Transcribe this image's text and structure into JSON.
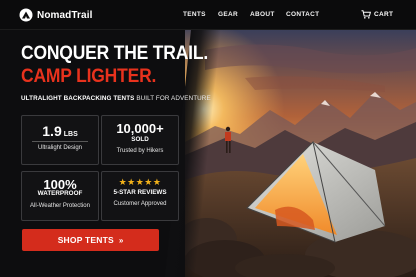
{
  "nav": {
    "brand": "NomadTrail",
    "links": [
      "TENTS",
      "GEAR",
      "ABOUT",
      "CONTACT"
    ],
    "cart_label": "CART",
    "brand_icon": "tent-logo-icon",
    "cart_icon": "cart-icon"
  },
  "hero": {
    "headline_1": "CONQUER THE TRAIL.",
    "headline_2": "CAMP LIGHTER.",
    "tagline_strong": "ULTRALIGHT BACKPACKING TENTS",
    "tagline_light": "BUILT FOR ADVENTURE",
    "accent_color": "#e8321d"
  },
  "features": [
    {
      "value": "1.9",
      "unit": "LBS",
      "label": "Ultralight Design"
    },
    {
      "value": "10,000+",
      "sub": "SOLD",
      "label": "Trusted by Hikers"
    },
    {
      "value": "100%",
      "sub": "WATERPROOF",
      "label": "All-Weather Protection"
    },
    {
      "stars": "★★★★★",
      "sub": "5-STAR REVIEWS",
      "label": "Customer Approved"
    }
  ],
  "cta": {
    "label": "SHOP TENTS",
    "arrow": "»",
    "color": "#d42c1c"
  }
}
